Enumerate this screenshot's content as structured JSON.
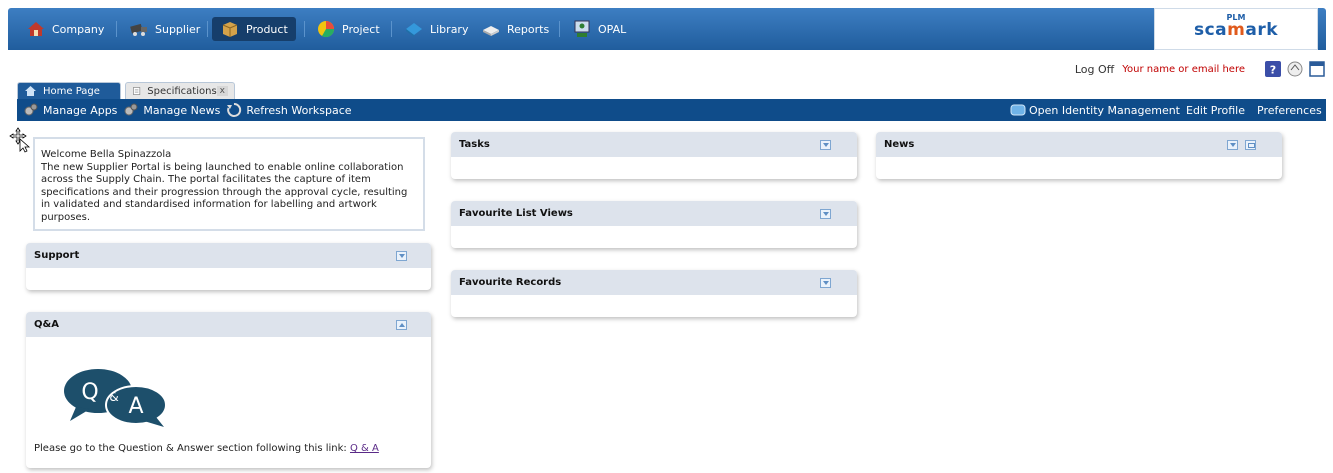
{
  "nav": {
    "items": [
      {
        "label": "Company",
        "icon": "house-icon"
      },
      {
        "label": "Supplier",
        "icon": "truck-icon"
      },
      {
        "label": "Product",
        "icon": "box-icon"
      },
      {
        "label": "Project",
        "icon": "pie-icon"
      },
      {
        "label": "Library",
        "icon": "book-icon"
      },
      {
        "label": "Reports",
        "icon": "report-icon"
      },
      {
        "label": "OPAL",
        "icon": "person-screen-icon"
      }
    ],
    "active": "Product"
  },
  "logo": {
    "top": "PLM",
    "brand_a": "sca",
    "brand_b": "m",
    "brand_c": "ark"
  },
  "user": {
    "logoff": "Log Off",
    "name_placeholder": "Your name or email here"
  },
  "tabs": [
    {
      "label": "Home Page"
    },
    {
      "label": "Specifications",
      "close": "x"
    }
  ],
  "toolbar": {
    "manage_apps": "Manage Apps",
    "manage_news": "Manage News",
    "refresh": "Refresh Workspace",
    "identity": "Open Identity Management",
    "edit_profile": "Edit Profile",
    "preferences": "Preferences"
  },
  "welcome": {
    "line1": "Welcome Bella Spinazzola",
    "body": "The new Supplier Portal is being launched to enable online collaboration across the Supply Chain. The portal facilitates the capture of item specifications and their progression through the approval cycle, resulting in validated and standardised information for labelling and artwork purposes."
  },
  "panels": {
    "support": "Support",
    "qa": "Q&A",
    "tasks": "Tasks",
    "fav_list": "Favourite List Views",
    "fav_records": "Favourite Records",
    "news": "News"
  },
  "qa": {
    "logo_q": "Q",
    "logo_amp": "&",
    "logo_a": "A",
    "text": "Please go to the Question & Answer section following this link:",
    "link": "Q & A"
  },
  "colors": {
    "nav": "#2a6aad",
    "toolbar": "#0f4c8a",
    "panel_header": "#dde3ec",
    "username": "#c00000"
  }
}
